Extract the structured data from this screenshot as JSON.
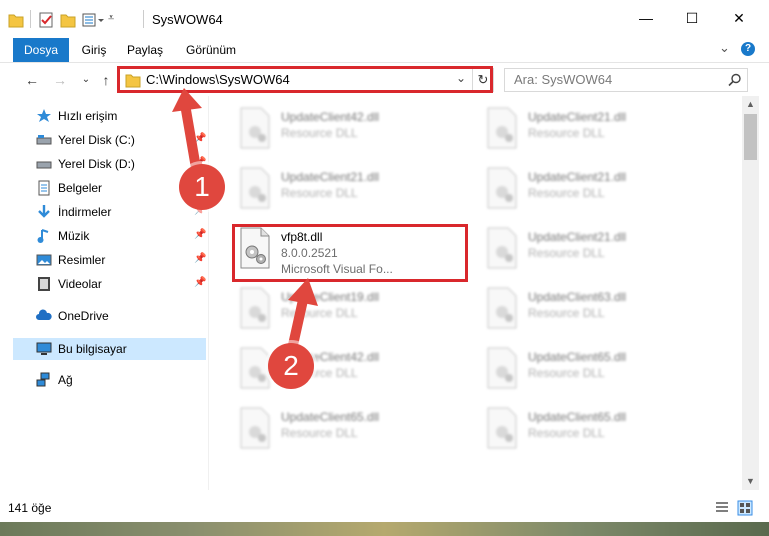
{
  "window": {
    "title": "SysWOW64",
    "minimize": "—",
    "maximize": "☐",
    "close": "✕"
  },
  "ribbon": {
    "tabs": [
      "Dosya",
      "Giriş",
      "Paylaş",
      "Görünüm"
    ],
    "active_tab": "Dosya",
    "expand": "⌄",
    "help": "?"
  },
  "address": {
    "path": "C:\\Windows\\SysWOW64",
    "dropdown": "⌄",
    "refresh": "↻",
    "search_placeholder": "Ara: SysWOW64"
  },
  "nav": {
    "back": "←",
    "forward": "→",
    "recent": "⌄",
    "up": "↑",
    "items": [
      {
        "label": "Hızlı erişim",
        "icon": "star-icon",
        "pinned": false
      },
      {
        "label": "Yerel Disk (C:)",
        "icon": "drive-icon",
        "pinned": true
      },
      {
        "label": "Yerel Disk (D:)",
        "icon": "drive-icon",
        "pinned": true
      },
      {
        "label": "Belgeler",
        "icon": "document-icon",
        "pinned": true
      },
      {
        "label": "İndirmeler",
        "icon": "download-icon",
        "pinned": true
      },
      {
        "label": "Müzik",
        "icon": "music-icon",
        "pinned": true
      },
      {
        "label": "Resimler",
        "icon": "pictures-icon",
        "pinned": true
      },
      {
        "label": "Videolar",
        "icon": "video-icon",
        "pinned": true
      },
      {
        "label": "OneDrive",
        "icon": "cloud-icon",
        "pinned": false
      },
      {
        "label": "Bu bilgisayar",
        "icon": "computer-icon",
        "pinned": false
      },
      {
        "label": "Ağ",
        "icon": "network-icon",
        "pinned": false
      }
    ],
    "selected": "Bu bilgisayar"
  },
  "files": {
    "left": [
      {
        "name": "UpdateClient42.dll",
        "line2": "Resource DLL",
        "line3": ""
      },
      {
        "name": "UpdateClient21.dll",
        "line2": "Resource DLL",
        "line3": ""
      },
      {
        "name": "vfp8t.dll",
        "line2": "8.0.0.2521",
        "line3": "Microsoft Visual Fo..."
      },
      {
        "name": "UpdateClient19.dll",
        "line2": "Resource DLL",
        "line3": ""
      },
      {
        "name": "UpdateClient42.dll",
        "line2": "Resource DLL",
        "line3": ""
      },
      {
        "name": "UpdateClient65.dll",
        "line2": "Resource DLL",
        "line3": ""
      }
    ],
    "right": [
      {
        "name": "UpdateClient21.dll",
        "line2": "Resource DLL",
        "line3": ""
      },
      {
        "name": "UpdateClient21.dll",
        "line2": "Resource DLL",
        "line3": ""
      },
      {
        "name": "UpdateClient21.dll",
        "line2": "Resource DLL",
        "line3": ""
      },
      {
        "name": "UpdateClient63.dll",
        "line2": "Resource DLL",
        "line3": ""
      },
      {
        "name": "UpdateClient65.dll",
        "line2": "Resource DLL",
        "line3": ""
      },
      {
        "name": "UpdateClient65.dll",
        "line2": "Resource DLL",
        "line3": ""
      }
    ],
    "highlighted": "vfp8t.dll"
  },
  "status": {
    "count": "141 öğe"
  },
  "annotations": {
    "marker1": "1",
    "marker2": "2",
    "marker_color": "#e0473e",
    "box_color": "#d9282c"
  },
  "colors": {
    "accent": "#1979ca",
    "selection": "#cce8ff"
  }
}
